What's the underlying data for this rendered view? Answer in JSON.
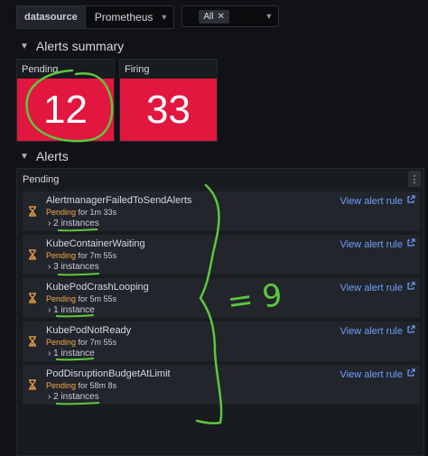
{
  "toolbar": {
    "datasource_label": "datasource",
    "datasource_value": "Prometheus",
    "filter_chip": "All"
  },
  "summary": {
    "section_title": "Alerts summary",
    "pending_title": "Pending",
    "pending_value": "12",
    "firing_title": "Firing",
    "firing_value": "33",
    "stat_color": "#e1173f"
  },
  "alerts": {
    "section_title": "Alerts",
    "panel_title": "Pending",
    "state_color": "#f5a64a",
    "link_color": "#6e9fff",
    "rows": [
      {
        "name": "AlertmanagerFailedToSendAlerts",
        "state": "Pending",
        "for_text": "for 1m 33s",
        "instances": "2 instances",
        "link": "View alert rule"
      },
      {
        "name": "KubeContainerWaiting",
        "state": "Pending",
        "for_text": "for 7m 55s",
        "instances": "3 instances",
        "link": "View alert rule"
      },
      {
        "name": "KubePodCrashLooping",
        "state": "Pending",
        "for_text": "for 5m 55s",
        "instances": "1 instance",
        "link": "View alert rule"
      },
      {
        "name": "KubePodNotReady",
        "state": "Pending",
        "for_text": "for 7m 55s",
        "instances": "1 instance",
        "link": "View alert rule"
      },
      {
        "name": "PodDisruptionBudgetAtLimit",
        "state": "Pending",
        "for_text": "for 58m 8s",
        "instances": "2 instances",
        "link": "View alert rule"
      }
    ]
  },
  "annotation": {
    "color": "#5cc73e",
    "handwritten_text": "= 9"
  }
}
